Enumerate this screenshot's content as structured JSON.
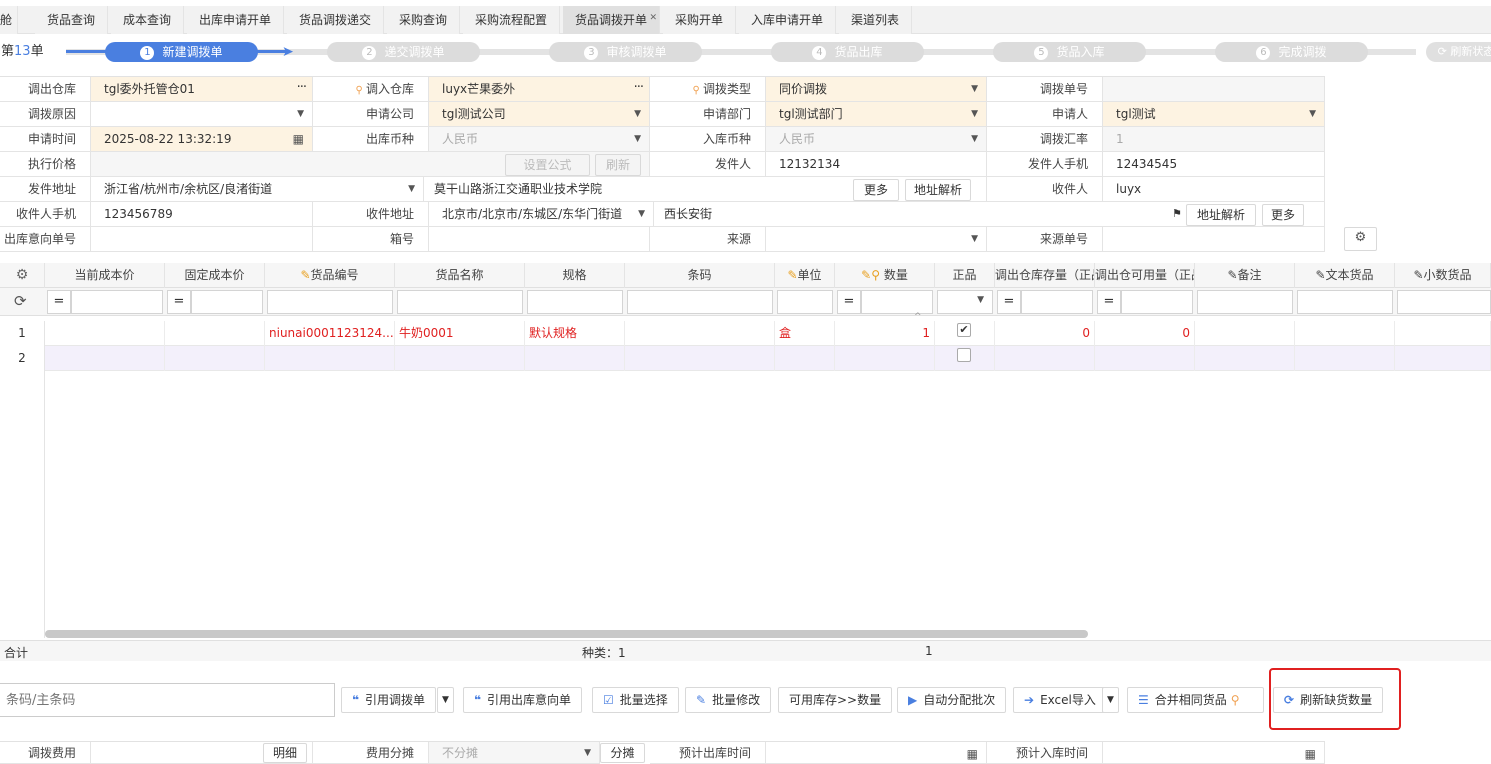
{
  "tabs": [
    {
      "label": "舱"
    },
    {
      "label": "货品查询"
    },
    {
      "label": "成本查询"
    },
    {
      "label": "出库申请开单"
    },
    {
      "label": "货品调拨递交"
    },
    {
      "label": "采购查询"
    },
    {
      "label": "采购流程配置"
    },
    {
      "label": "货品调拨开单"
    },
    {
      "label": "采购开单"
    },
    {
      "label": "入库申请开单"
    },
    {
      "label": "渠道列表"
    }
  ],
  "page": {
    "prefix": "调第",
    "count": "13",
    "suffix": "单",
    "refresh_status": "刷新状态"
  },
  "steps": [
    {
      "num": "1",
      "label": "新建调拨单"
    },
    {
      "num": "2",
      "label": "递交调拨单"
    },
    {
      "num": "3",
      "label": "审核调拨单"
    },
    {
      "num": "4",
      "label": "货品出库"
    },
    {
      "num": "5",
      "label": "货品入库"
    },
    {
      "num": "6",
      "label": "完成调拨"
    }
  ],
  "form": {
    "out_wh_label": "调出仓库",
    "out_wh": "tgl委外托管仓01",
    "in_wh_label": "调入仓库",
    "in_wh": "luyx芒果委外",
    "type_label": "调拨类型",
    "type": "同价调拨",
    "order_no_label": "调拨单号",
    "order_no": "",
    "reason_label": "调拨原因",
    "reason": "",
    "company_label": "申请公司",
    "company": "tgl测试公司",
    "dept_label": "申请部门",
    "dept": "tgl测试部门",
    "applicant_label": "申请人",
    "applicant": "tgl测试",
    "apply_time_label": "申请时间",
    "apply_time": "2025-08-22 13:32:19",
    "out_currency_label": "出库币种",
    "out_currency": "人民币",
    "in_currency_label": "入库币种",
    "in_currency": "人民币",
    "rate_label": "调拨汇率",
    "rate": "1",
    "exec_price_label": "执行价格",
    "set_formula": "设置公式",
    "refresh": "刷新",
    "sender_label": "发件人",
    "sender": "12132134",
    "sender_phone_label": "发件人手机",
    "sender_phone": "12434545",
    "send_addr_label": "发件地址",
    "send_addr": "浙江省/杭州市/余杭区/良渚街道",
    "send_addr_detail": "莫干山路浙江交通职业技术学院",
    "more": "更多",
    "parse_addr": "地址解析",
    "receiver_label": "收件人",
    "receiver": "luyx",
    "receiver_phone_label": "收件人手机",
    "receiver_phone": "123456789",
    "recv_addr_label": "收件地址",
    "recv_addr": "北京市/北京市/东城区/东华门街道",
    "recv_addr_detail": "西长安街",
    "intent_no_label": "出库意向单号",
    "intent_no": "",
    "box_label": "箱号",
    "box": "",
    "source_label": "来源",
    "source": "",
    "source_no_label": "来源单号",
    "source_no": ""
  },
  "grid": {
    "headers": [
      "当前成本价",
      "固定成本价",
      "货品编号",
      "货品名称",
      "规格",
      "条码",
      "单位",
      "数量",
      "正品",
      "调出仓库存量（正品）",
      "调出仓可用量（正品）",
      "备注",
      "文本货品",
      "小数货品"
    ],
    "rows": [
      {
        "no": "1",
        "cost": "",
        "fixed": "",
        "code": "niunai0001123124...",
        "name": "牛奶0001",
        "spec": "默认规格",
        "barcode": "",
        "unit": "盒",
        "qty": "1",
        "genuine": true,
        "stock": "0",
        "avail": "0"
      },
      {
        "no": "2",
        "cost": "",
        "fixed": "",
        "code": "",
        "name": "",
        "spec": "",
        "barcode": "",
        "unit": "",
        "qty": "",
        "genuine": false,
        "stock": "",
        "avail": ""
      }
    ]
  },
  "summary": {
    "total_label": "合计",
    "kinds": "种类：1",
    "qty_total": "1"
  },
  "toolbar": {
    "barcode_placeholder": "条码/主条码",
    "ref_transfer": "引用调拨单",
    "ref_intent": "引用出库意向单",
    "batch_select": "批量选择",
    "batch_edit": "批量修改",
    "avail_to_qty": "可用库存>>数量",
    "auto_batch": "自动分配批次",
    "excel_import": "Excel导入",
    "merge_same": "合并相同货品",
    "refresh_shortage": "刷新缺货数量"
  },
  "footer": {
    "fee_label": "调拨费用",
    "detail": "明细",
    "fee_split_label": "费用分摊",
    "fee_split": "不分摊",
    "split_btn": "分摊",
    "est_out_label": "预计出库时间",
    "est_in_label": "预计入库时间"
  },
  "colors": {
    "accent": "#4a7fe0",
    "highlight_box": "#e02020",
    "required_bg": "#fdf3e2"
  }
}
